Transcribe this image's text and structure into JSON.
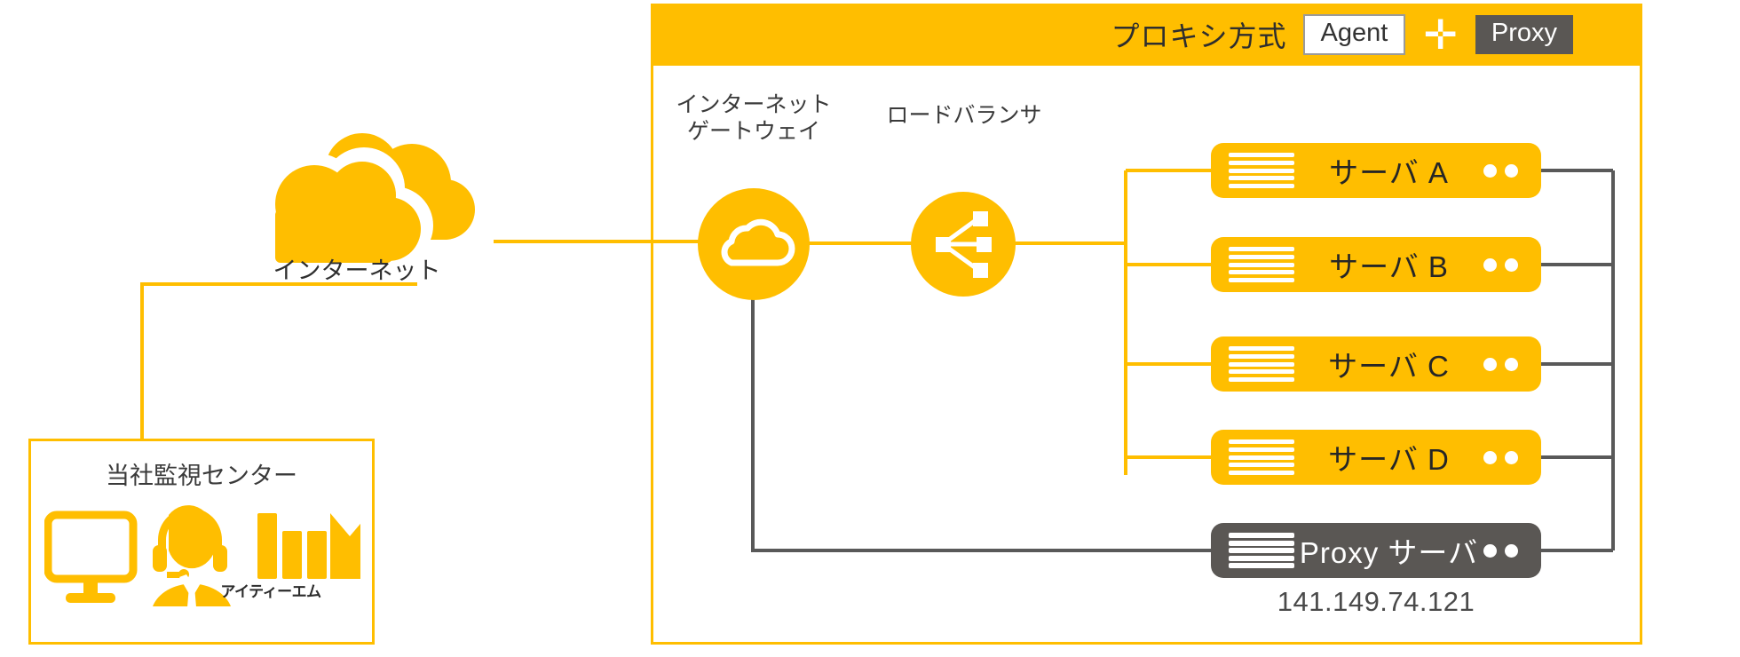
{
  "frame": {
    "title": "プロキシ方式",
    "badge_agent": "Agent",
    "plus": "✛",
    "badge_proxy": "Proxy"
  },
  "internet": {
    "label": "インターネット",
    "icon": "cloud-icon"
  },
  "gateway": {
    "label": "インターネット\nゲートウェイ",
    "icon": "internet-gateway-cloud-icon"
  },
  "load_balancer": {
    "label": "ロードバランサ",
    "icon": "load-balancer-icon"
  },
  "servers": [
    {
      "name": "サーバ A",
      "style": "orange",
      "icon": "server-rack-icon"
    },
    {
      "name": "サーバ B",
      "style": "orange",
      "icon": "server-rack-icon"
    },
    {
      "name": "サーバ C",
      "style": "orange",
      "icon": "server-rack-icon"
    },
    {
      "name": "サーバ D",
      "style": "orange",
      "icon": "server-rack-icon"
    },
    {
      "name": "Proxy サーバ",
      "style": "gray",
      "icon": "server-rack-icon"
    }
  ],
  "proxy_ip": "141.149.74.121",
  "monitoring_center": {
    "title": "当社監視センター",
    "company_label": "アイティーエム",
    "icons": [
      "monitor-icon",
      "operator-headset-icon",
      "itm-logo-icon"
    ]
  },
  "colors": {
    "orange": "#FFBE00",
    "gray": "#5a5754",
    "line_gray": "#595959",
    "text_dark": "#2e2e2e",
    "white": "#ffffff"
  }
}
